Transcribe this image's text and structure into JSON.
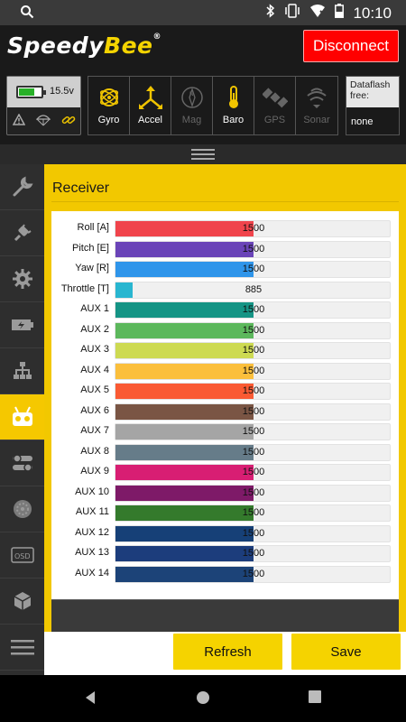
{
  "status_bar": {
    "time": "10:10"
  },
  "header": {
    "logo_part1": "Speedy",
    "logo_part2": "Bee",
    "logo_mark": "®",
    "disconnect_label": "Disconnect"
  },
  "battery": {
    "voltage": "15.5v",
    "level": 0.7,
    "color": "#28b028"
  },
  "sensors": [
    {
      "label": "Gyro",
      "icon": "gyro-icon",
      "active": true
    },
    {
      "label": "Accel",
      "icon": "accel-icon",
      "active": true
    },
    {
      "label": "Mag",
      "icon": "compass-icon",
      "active": false
    },
    {
      "label": "Baro",
      "icon": "thermometer-icon",
      "active": true
    },
    {
      "label": "GPS",
      "icon": "satellite-icon",
      "active": false
    },
    {
      "label": "Sonar",
      "icon": "sonar-icon",
      "active": false
    }
  ],
  "dataflash": {
    "label": "Dataflash free:",
    "value": "none"
  },
  "sidebar": {
    "items": [
      {
        "icon": "wrench-icon"
      },
      {
        "icon": "plug-icon"
      },
      {
        "icon": "gear-icon"
      },
      {
        "icon": "battery-icon"
      },
      {
        "icon": "network-icon"
      },
      {
        "icon": "receiver-icon",
        "active": true
      },
      {
        "icon": "modes-icon"
      },
      {
        "icon": "motor-icon"
      },
      {
        "icon": "osd-icon",
        "text": "OSD"
      },
      {
        "icon": "cube-icon"
      },
      {
        "icon": "menu-icon"
      }
    ]
  },
  "receiver": {
    "title": "Receiver",
    "range_min": 800,
    "range_max": 2200,
    "channels": [
      {
        "label": "Roll [A]",
        "value": "1500",
        "color": "#f0444c"
      },
      {
        "label": "Pitch [E]",
        "value": "1500",
        "color": "#6a44b8"
      },
      {
        "label": "Yaw [R]",
        "value": "1500",
        "color": "#2f95ea"
      },
      {
        "label": "Throttle [T]",
        "value": "885",
        "color": "#29b6d0"
      },
      {
        "label": "AUX 1",
        "value": "1500",
        "color": "#159485"
      },
      {
        "label": "AUX 2",
        "value": "1500",
        "color": "#5cb85c"
      },
      {
        "label": "AUX 3",
        "value": "1500",
        "color": "#cdda52"
      },
      {
        "label": "AUX 4",
        "value": "1500",
        "color": "#fbbf3c"
      },
      {
        "label": "AUX 5",
        "value": "1500",
        "color": "#fa5a33"
      },
      {
        "label": "AUX 6",
        "value": "1500",
        "color": "#7a5544"
      },
      {
        "label": "AUX 7",
        "value": "1500",
        "color": "#a5a5a5"
      },
      {
        "label": "AUX 8",
        "value": "1500",
        "color": "#667c89"
      },
      {
        "label": "AUX 9",
        "value": "1500",
        "color": "#d81e73"
      },
      {
        "label": "AUX 10",
        "value": "1500",
        "color": "#7e1a68"
      },
      {
        "label": "AUX 11",
        "value": "1500",
        "color": "#347a2c"
      },
      {
        "label": "AUX 12",
        "value": "1500",
        "color": "#164077"
      },
      {
        "label": "AUX 13",
        "value": "1500",
        "color": "#1c3d7c"
      },
      {
        "label": "AUX 14",
        "value": "1500",
        "color": "#1c4378"
      }
    ]
  },
  "footer": {
    "refresh_label": "Refresh",
    "save_label": "Save"
  },
  "colors": {
    "accent": "#f2c800",
    "danger": "#ff0000"
  }
}
